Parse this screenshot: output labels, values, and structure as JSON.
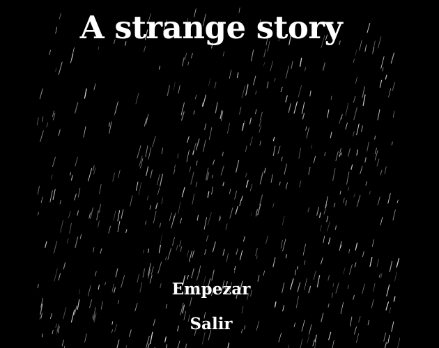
{
  "game": {
    "title": "A strange story"
  },
  "menu": {
    "start_label": "Empezar",
    "exit_label": "Salir"
  },
  "colors": {
    "background": "#000000",
    "text": "#ffffff",
    "rain": "#ffffff"
  },
  "effects": {
    "background_effect": "falling-rain"
  }
}
